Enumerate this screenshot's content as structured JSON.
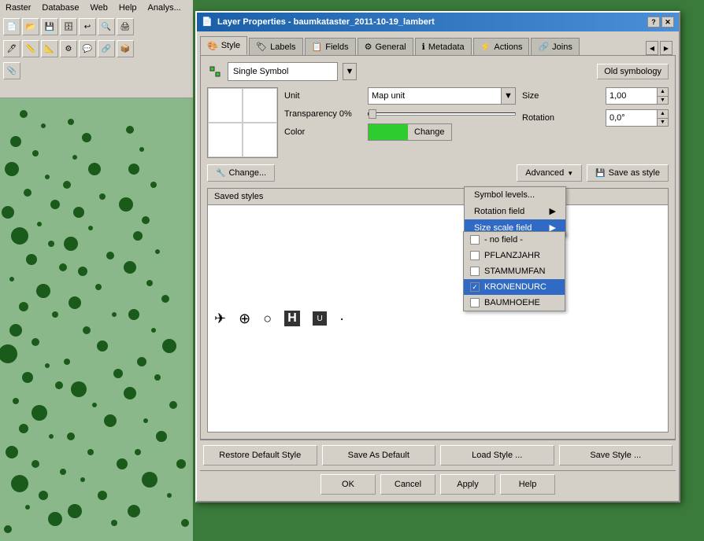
{
  "window": {
    "title": "Layer Properties - baumkataster_2011-10-19_lambert",
    "icon": "📄"
  },
  "titlebar_buttons": {
    "help": "?",
    "close": "✕"
  },
  "tabs": [
    {
      "id": "style",
      "label": "Style",
      "icon": "🎨",
      "active": true
    },
    {
      "id": "labels",
      "label": "Labels",
      "icon": "🏷"
    },
    {
      "id": "fields",
      "label": "Fields",
      "icon": "📋"
    },
    {
      "id": "general",
      "label": "General",
      "icon": "⚙"
    },
    {
      "id": "metadata",
      "label": "Metadata",
      "icon": "ℹ"
    },
    {
      "id": "actions",
      "label": "Actions",
      "icon": "⚡"
    },
    {
      "id": "joins",
      "label": "Joins",
      "icon": "🔗"
    }
  ],
  "symbol_type": {
    "label": "Single Symbol",
    "dropdown_arrow": "▼"
  },
  "old_symbology_btn": "Old symbology",
  "properties": {
    "unit_label": "Unit",
    "unit_value": "Map unit",
    "transparency_label": "Transparency 0%",
    "transparency_slider": 0,
    "color_label": "Color",
    "color_btn_label": "Change",
    "size_label": "Size",
    "size_value": "1,00",
    "rotation_label": "Rotation",
    "rotation_value": "0,0°"
  },
  "change_btn": "Change...",
  "advanced_btn": "Advanced",
  "advanced_dropdown_arrow": "▼",
  "save_as_style_btn": "Save as style",
  "advanced_menu": {
    "items": [
      {
        "id": "symbol-levels",
        "label": "Symbol levels...",
        "has_arrow": false
      },
      {
        "id": "rotation-field",
        "label": "Rotation field",
        "has_arrow": true
      },
      {
        "id": "size-scale-field",
        "label": "Size scale field",
        "has_arrow": true,
        "active": true
      }
    ]
  },
  "size_scale_submenu": {
    "items": [
      {
        "id": "no-field",
        "label": "- no field -",
        "checked": false
      },
      {
        "id": "pflanzjahr",
        "label": "PFLANZJAHR",
        "checked": false
      },
      {
        "id": "stammumfan",
        "label": "STAMMUMFAN",
        "checked": false
      },
      {
        "id": "kronendurc",
        "label": "KRONENDURC",
        "checked": true,
        "selected": true
      },
      {
        "id": "baumhoehe",
        "label": "BAUMHOEHE",
        "checked": false
      }
    ]
  },
  "saved_styles": {
    "label": "Saved styles",
    "symbols": [
      {
        "icon": "✈",
        "name": "airplane"
      },
      {
        "icon": "⊕",
        "name": "crosshair"
      },
      {
        "icon": "○",
        "name": "circle"
      },
      {
        "icon": "⊕",
        "name": "hospital"
      },
      {
        "icon": "⊔",
        "name": "square"
      },
      {
        "icon": "·",
        "name": "dot"
      }
    ]
  },
  "bottom_buttons": [
    {
      "id": "restore-default",
      "label": "Restore Default Style"
    },
    {
      "id": "save-as-default",
      "label": "Save As Default"
    },
    {
      "id": "load-style",
      "label": "Load Style ..."
    },
    {
      "id": "save-style",
      "label": "Save Style ..."
    }
  ],
  "action_buttons": [
    {
      "id": "ok",
      "label": "OK"
    },
    {
      "id": "cancel",
      "label": "Cancel"
    },
    {
      "id": "apply",
      "label": "Apply"
    },
    {
      "id": "help",
      "label": "Help"
    }
  ],
  "menubar": {
    "items": [
      "Raster",
      "Database",
      "Web",
      "Help",
      "Analys..."
    ]
  }
}
